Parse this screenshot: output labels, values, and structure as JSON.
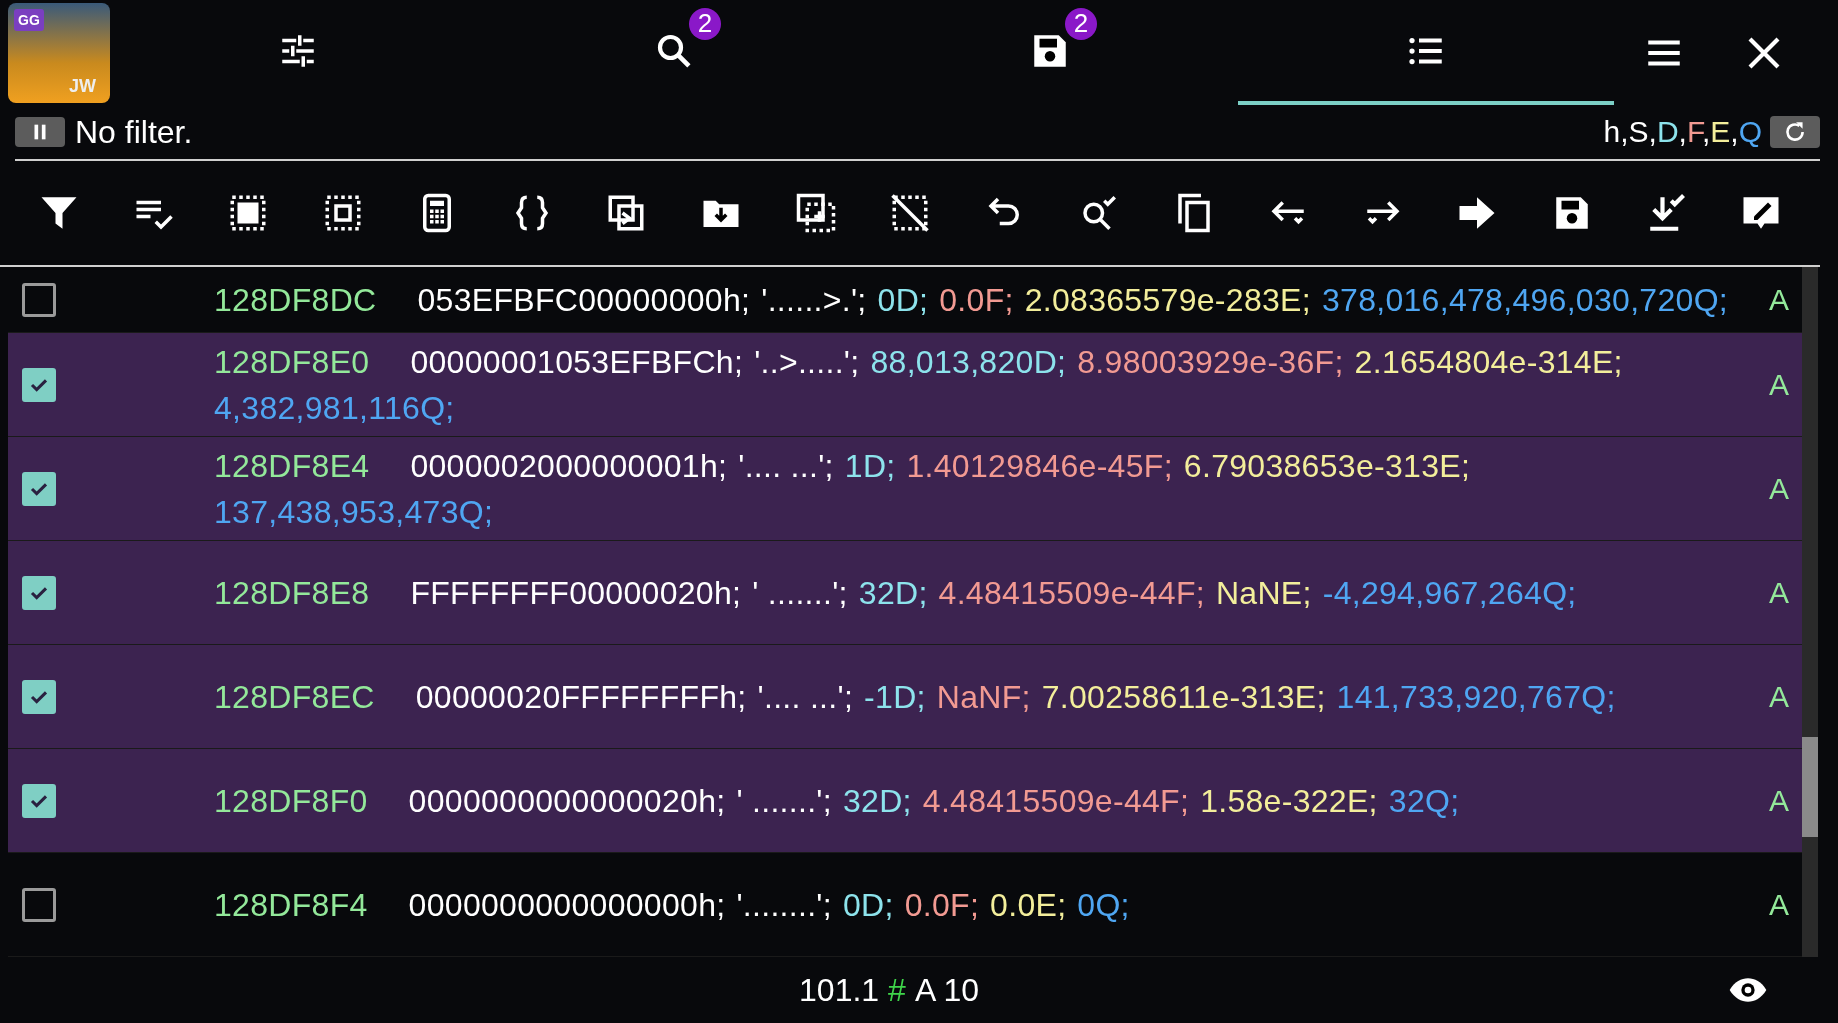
{
  "app_icon": {
    "top_label": "GG",
    "bottom_label": "JW"
  },
  "top_tabs": [
    {
      "kind": "tune",
      "selected": false
    },
    {
      "kind": "search",
      "badge": "2",
      "selected": false
    },
    {
      "kind": "save",
      "badge": "2",
      "selected": false
    },
    {
      "kind": "list",
      "selected": true
    }
  ],
  "filter": {
    "label": "No filter."
  },
  "type_legend": [
    {
      "text": "h,S,",
      "kind": "h"
    },
    {
      "text": "D",
      "kind": "D"
    },
    {
      "text": ",",
      "kind": "h"
    },
    {
      "text": "F",
      "kind": "F"
    },
    {
      "text": ",",
      "kind": "h"
    },
    {
      "text": "E",
      "kind": "E"
    },
    {
      "text": ",",
      "kind": "h"
    },
    {
      "text": "Q",
      "kind": "Q"
    }
  ],
  "rows": [
    {
      "checked": false,
      "address": "128DF8DC",
      "type": "A",
      "values": [
        {
          "kind": "h",
          "text": "053EFBFC00000000h;"
        },
        {
          "kind": "s",
          "text": "'......>.';"
        },
        {
          "kind": "D",
          "text": "0D;"
        },
        {
          "kind": "F",
          "text": "0.0F;"
        },
        {
          "kind": "E",
          "text": "2.08365579e-283E;"
        },
        {
          "kind": "Q",
          "text": "378,016,478,496,030,720Q;"
        }
      ]
    },
    {
      "checked": true,
      "address": "128DF8E0",
      "type": "A",
      "values": [
        {
          "kind": "h",
          "text": "00000001053EFBFCh;"
        },
        {
          "kind": "s",
          "text": "'..>.....';"
        },
        {
          "kind": "D",
          "text": "88,013,820D;"
        },
        {
          "kind": "F",
          "text": "8.98003929e-36F;"
        },
        {
          "kind": "E",
          "text": "2.1654804e-314E;"
        },
        {
          "kind": "Q",
          "text": "4,382,981,116Q;"
        }
      ]
    },
    {
      "checked": true,
      "address": "128DF8E4",
      "type": "A",
      "values": [
        {
          "kind": "h",
          "text": "0000002000000001h;"
        },
        {
          "kind": "s",
          "text": "'.... ...';"
        },
        {
          "kind": "D",
          "text": "1D;"
        },
        {
          "kind": "F",
          "text": "1.40129846e-45F;"
        },
        {
          "kind": "E",
          "text": "6.79038653e-313E;"
        },
        {
          "kind": "Q",
          "text": "137,438,953,473Q;"
        }
      ]
    },
    {
      "checked": true,
      "address": "128DF8E8",
      "type": "A",
      "values": [
        {
          "kind": "h",
          "text": "FFFFFFFF00000020h;"
        },
        {
          "kind": "s",
          "text": "' .......';"
        },
        {
          "kind": "D",
          "text": "32D;"
        },
        {
          "kind": "F",
          "text": "4.48415509e-44F;"
        },
        {
          "kind": "E",
          "text": "NaNE;"
        },
        {
          "kind": "Q",
          "text": "-4,294,967,264Q;"
        }
      ]
    },
    {
      "checked": true,
      "address": "128DF8EC",
      "type": "A",
      "values": [
        {
          "kind": "h",
          "text": "00000020FFFFFFFFh;"
        },
        {
          "kind": "s",
          "text": "'.... ...';"
        },
        {
          "kind": "D",
          "text": "-1D;"
        },
        {
          "kind": "F",
          "text": "NaNF;"
        },
        {
          "kind": "E",
          "text": "7.00258611e-313E;"
        },
        {
          "kind": "Q",
          "text": "141,733,920,767Q;"
        }
      ]
    },
    {
      "checked": true,
      "address": "128DF8F0",
      "type": "A",
      "values": [
        {
          "kind": "h",
          "text": "0000000000000020h;"
        },
        {
          "kind": "s",
          "text": "' .......';"
        },
        {
          "kind": "D",
          "text": "32D;"
        },
        {
          "kind": "F",
          "text": "4.48415509e-44F;"
        },
        {
          "kind": "E",
          "text": "1.58e-322E;"
        },
        {
          "kind": "Q",
          "text": "32Q;"
        }
      ]
    },
    {
      "checked": false,
      "address": "128DF8F4",
      "type": "A",
      "values": [
        {
          "kind": "h",
          "text": "0000000000000000h;"
        },
        {
          "kind": "s",
          "text": "'........';"
        },
        {
          "kind": "D",
          "text": "0D;"
        },
        {
          "kind": "F",
          "text": "0.0F;"
        },
        {
          "kind": "E",
          "text": "0.0E;"
        },
        {
          "kind": "Q",
          "text": "0Q;"
        }
      ]
    }
  ],
  "status": [
    {
      "text": "101.1",
      "kind": "plain"
    },
    {
      "text": "#",
      "kind": "accent"
    },
    {
      "text": "A 10",
      "kind": "plain"
    }
  ]
}
